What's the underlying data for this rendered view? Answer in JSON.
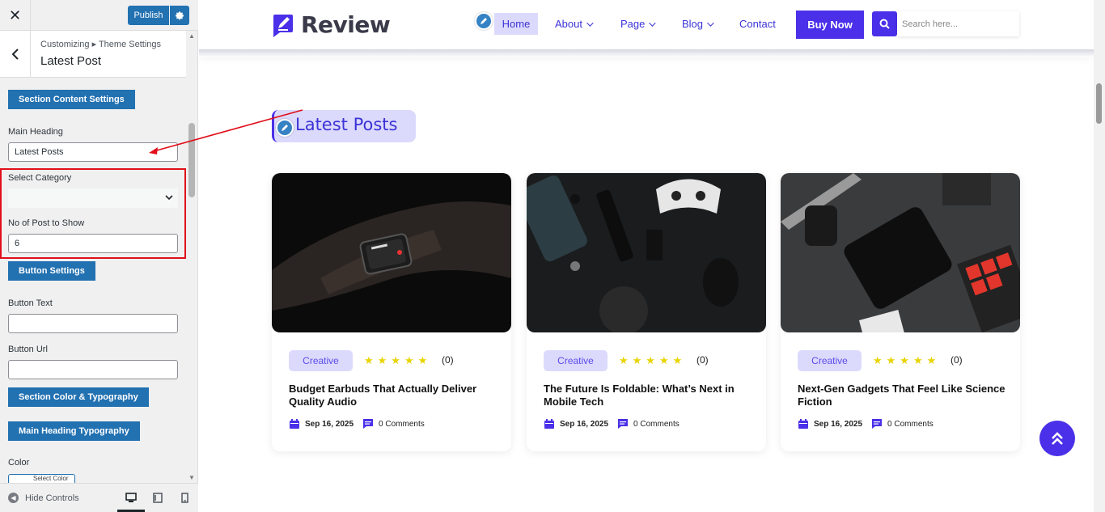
{
  "customizer": {
    "publish_label": "Publish",
    "breadcrumb": "Customizing ▸ Theme Settings",
    "section_title": "Latest Post",
    "section_content_settings": "Section Content Settings",
    "main_heading_label": "Main Heading",
    "main_heading_value": "Latest Posts",
    "select_category_label": "Select Category",
    "select_category_value": "",
    "no_of_posts_label": "No of Post to Show",
    "no_of_posts_value": "6",
    "button_settings": "Button Settings",
    "button_text_label": "Button Text",
    "button_text_value": "",
    "button_url_label": "Button Url",
    "button_url_value": "",
    "section_color_typography": "Section Color & Typography",
    "main_heading_typography": "Main Heading Typography",
    "color_label": "Color",
    "select_color_label": "Select Color",
    "hide_controls": "Hide Controls"
  },
  "site": {
    "logo_text": "Review",
    "nav": [
      {
        "label": "Home"
      },
      {
        "label": "About"
      },
      {
        "label": "Page"
      },
      {
        "label": "Blog"
      },
      {
        "label": "Contact"
      }
    ],
    "buy_now": "Buy Now",
    "search_placeholder": "Search here...",
    "section_heading": "Latest Posts",
    "posts": [
      {
        "category": "Creative",
        "rating": "(0)",
        "title": "Budget Earbuds That Actually Deliver Quality Audio",
        "date": "Sep 16, 2025",
        "comments": "0 Comments"
      },
      {
        "category": "Creative",
        "rating": "(0)",
        "title": "The Future Is Foldable: What’s Next in Mobile Tech",
        "date": "Sep 16, 2025",
        "comments": "0 Comments"
      },
      {
        "category": "Creative",
        "rating": "(0)",
        "title": "Next-Gen Gadgets That Feel Like Science Fiction",
        "date": "Sep 16, 2025",
        "comments": "0 Comments"
      }
    ]
  },
  "colors": {
    "accent": "#4a30e8",
    "accent_light": "#dcdafc",
    "wp_blue": "#2271b1",
    "star": "#e8d400",
    "highlight": "#e10f1a"
  }
}
